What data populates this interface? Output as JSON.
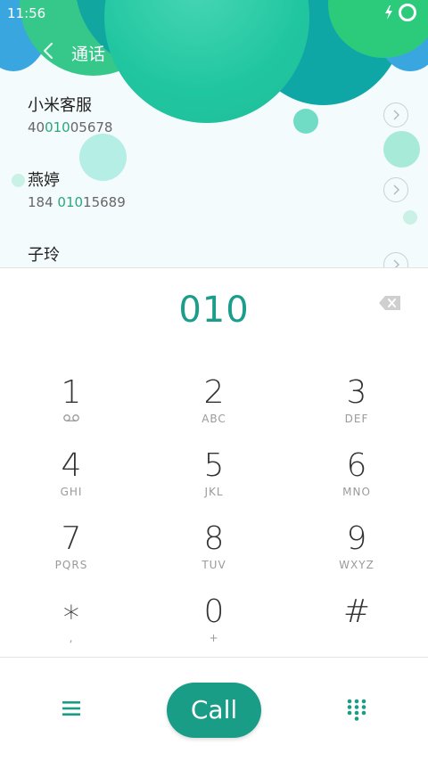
{
  "status_bar": {
    "time": "11:56"
  },
  "header": {
    "title": "通话"
  },
  "contacts": [
    {
      "name": "小米客服",
      "number_pre": "40",
      "number_match": "010",
      "number_post": "05678"
    },
    {
      "name": "燕婷",
      "number_pre": "184 ",
      "number_match": "010",
      "number_post": "15689"
    },
    {
      "name": "子玲",
      "number_pre": "",
      "number_match": "",
      "number_post": ""
    }
  ],
  "dialer": {
    "number": "010"
  },
  "keypad": [
    {
      "digit": "1",
      "letters": ""
    },
    {
      "digit": "2",
      "letters": "ABC"
    },
    {
      "digit": "3",
      "letters": "DEF"
    },
    {
      "digit": "4",
      "letters": "GHI"
    },
    {
      "digit": "5",
      "letters": "JKL"
    },
    {
      "digit": "6",
      "letters": "MNO"
    },
    {
      "digit": "7",
      "letters": "PQRS"
    },
    {
      "digit": "8",
      "letters": "TUV"
    },
    {
      "digit": "9",
      "letters": "WXYZ"
    },
    {
      "digit": "∗",
      "letters": ","
    },
    {
      "digit": "0",
      "letters": "+"
    },
    {
      "digit": "#",
      "letters": ""
    }
  ],
  "bottom_bar": {
    "call_label": "Call"
  },
  "icons": {
    "voicemail": "voicemail-icon",
    "back": "back-arrow-icon",
    "backspace": "backspace-icon",
    "menu": "menu-icon",
    "dialpad": "dialpad-icon",
    "battery": "battery-ring-icon",
    "charging": "bolt-icon"
  },
  "colors": {
    "accent": "#1a9d86",
    "highlight": "#2aa77a"
  }
}
